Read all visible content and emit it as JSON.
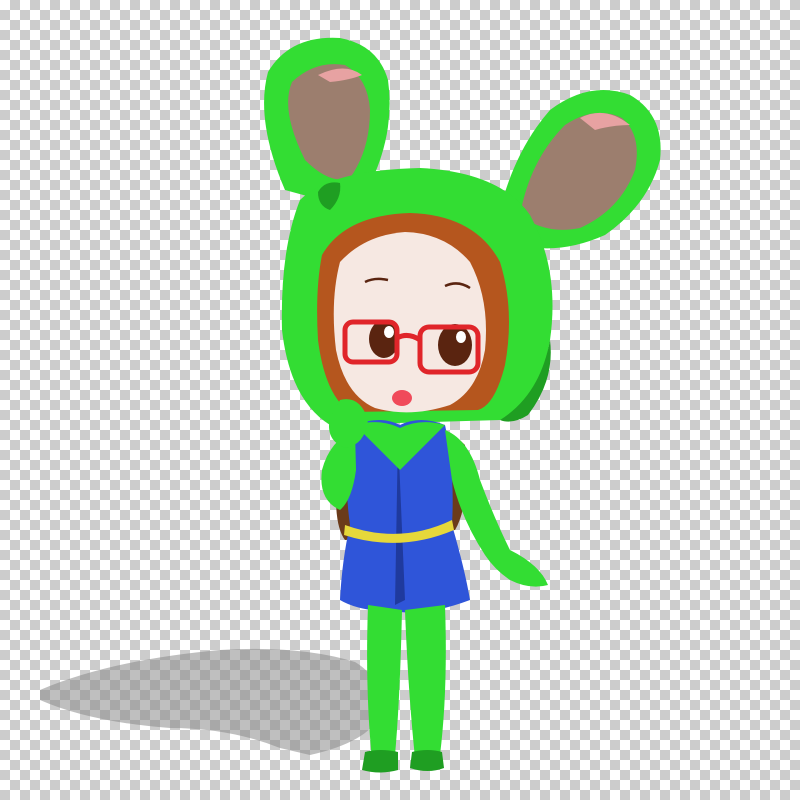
{
  "scene": {
    "subject": "chibi-character-green-bunny-hood",
    "background": "transparency-checkerboard"
  },
  "colors": {
    "checker_light": "#ffffff",
    "checker_dark": "#cccccc",
    "suit_green": "#33dd33",
    "suit_green_dark": "#1f9e22",
    "suit_green_light": "#7af07a",
    "ear_inner": "#9c7e6e",
    "ear_inner_pink": "#e7a2a2",
    "skin": "#f6e8e2",
    "hair": "#b5561e",
    "hair_dark": "#7a3410",
    "glasses": "#e0252a",
    "eye": "#5a2410",
    "mouth": "#f04a5a",
    "dress_blue": "#2f55d9",
    "dress_blue_dark": "#1f3a9e",
    "belt_yellow": "#e6d83a",
    "backpack_brown": "#6b3b1a",
    "shadow": "#8a8a8a"
  }
}
